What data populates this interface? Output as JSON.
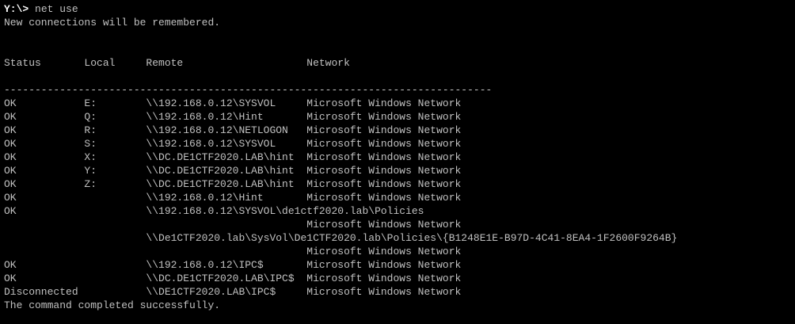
{
  "terminal": {
    "prompt": "Y:\\>",
    "command": " net use",
    "lines": [
      "New connections will be remembered.",
      "",
      "",
      "Status       Local     Remote                    Network",
      "",
      "-------------------------------------------------------------------------------",
      "OK           E:        \\\\192.168.0.12\\SYSVOL     Microsoft Windows Network",
      "OK           Q:        \\\\192.168.0.12\\Hint       Microsoft Windows Network",
      "OK           R:        \\\\192.168.0.12\\NETLOGON   Microsoft Windows Network",
      "OK           S:        \\\\192.168.0.12\\SYSVOL     Microsoft Windows Network",
      "OK           X:        \\\\DC.DE1CTF2020.LAB\\hint  Microsoft Windows Network",
      "OK           Y:        \\\\DC.DE1CTF2020.LAB\\hint  Microsoft Windows Network",
      "OK           Z:        \\\\DC.DE1CTF2020.LAB\\hint  Microsoft Windows Network",
      "OK                     \\\\192.168.0.12\\Hint       Microsoft Windows Network",
      "OK                     \\\\192.168.0.12\\SYSVOL\\de1ctf2020.lab\\Policies",
      "                                                 Microsoft Windows Network",
      "                       \\\\De1CTF2020.lab\\SysVol\\De1CTF2020.lab\\Policies\\{B1248E1E-B97D-4C41-8EA4-1F2600F9264B}",
      "                                                 Microsoft Windows Network",
      "OK                     \\\\192.168.0.12\\IPC$       Microsoft Windows Network",
      "OK                     \\\\DC.DE1CTF2020.LAB\\IPC$  Microsoft Windows Network",
      "Disconnected           \\\\DE1CTF2020.LAB\\IPC$     Microsoft Windows Network",
      "The command completed successfully."
    ]
  }
}
